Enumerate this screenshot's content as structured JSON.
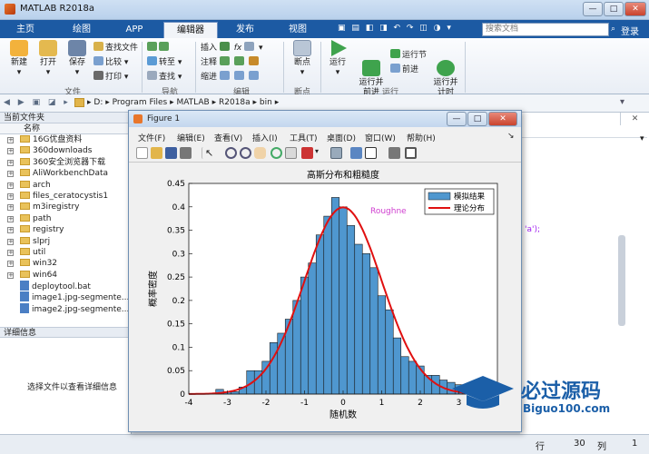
{
  "app": {
    "title": "MATLAB R2018a"
  },
  "window_controls": {
    "minimize": "—",
    "maximize": "□",
    "close": "✕"
  },
  "tabs": [
    {
      "label": "主页"
    },
    {
      "label": "绘图"
    },
    {
      "label": "APP"
    },
    {
      "label": "编辑器"
    },
    {
      "label": "发布"
    },
    {
      "label": "视图"
    }
  ],
  "search": {
    "placeholder": "搜索文档",
    "login": "登录"
  },
  "ribbon": {
    "file": {
      "new": "新建",
      "open": "打开",
      "save": "保存",
      "find_files": "查找文件",
      "compare": "比较",
      "print": "打印",
      "group": "文件"
    },
    "nav": {
      "goto": "转至",
      "find": "查找",
      "group": "导航"
    },
    "edit": {
      "insert": "插入",
      "comment": "注释",
      "indent": "缩进",
      "fx": "fx",
      "group": "编辑"
    },
    "breakpoints": {
      "label": "断点",
      "group": "断点"
    },
    "run": {
      "run": "运行",
      "run_advance": "运行并\n前进",
      "run_section": "运行节",
      "advance": "前进",
      "run_time": "运行并\n计时",
      "group": "运行"
    }
  },
  "address": {
    "path": [
      "D:",
      "Program Files",
      "MATLAB",
      "R2018a",
      "bin"
    ]
  },
  "current_folder": {
    "title": "当前文件夹",
    "col_name": "名称",
    "items": [
      {
        "name": "16G优盘资料",
        "type": "folder"
      },
      {
        "name": "360downloads",
        "type": "folder"
      },
      {
        "name": "360安全浏览器下载",
        "type": "folder"
      },
      {
        "name": "AliWorkbenchData",
        "type": "folder"
      },
      {
        "name": "arch",
        "type": "folder"
      },
      {
        "name": "files_ceratocystis1",
        "type": "folder"
      },
      {
        "name": "m3iregistry",
        "type": "folder"
      },
      {
        "name": "path",
        "type": "folder"
      },
      {
        "name": "registry",
        "type": "folder"
      },
      {
        "name": "slprj",
        "type": "folder"
      },
      {
        "name": "util",
        "type": "folder"
      },
      {
        "name": "win32",
        "type": "folder"
      },
      {
        "name": "win64",
        "type": "folder"
      },
      {
        "name": "deploytool.bat",
        "type": "file"
      },
      {
        "name": "image1.jpg-segmente...",
        "type": "file"
      },
      {
        "name": "image2.jpg-segmente...",
        "type": "file"
      }
    ]
  },
  "details": {
    "title": "详细信息",
    "hint": "选择文件以查看详细信息"
  },
  "editor_snippet": "'a');",
  "status": {
    "row_label": "行",
    "row": "30",
    "col_label": "列",
    "col": "1"
  },
  "figure": {
    "title": "Figure 1",
    "menu": [
      "文件(F)",
      "编辑(E)",
      "查看(V)",
      "插入(I)",
      "工具(T)",
      "桌面(D)",
      "窗口(W)",
      "帮助(H)"
    ],
    "overlay_text": "Roughne"
  },
  "colors": {
    "bars": "#4f97cf",
    "bar_edge": "#1a1a1a",
    "curve": "#e01010",
    "ribbon_tab": "#1c5aa3",
    "overlay": "#d040d0"
  },
  "chart_data": {
    "type": "bar",
    "title": "高斯分布和粗糙度",
    "xlabel": "随机数",
    "ylabel": "概率密度",
    "xlim": [
      -4,
      4
    ],
    "ylim": [
      0,
      0.45
    ],
    "xticks": [
      -4,
      -3,
      -2,
      -1,
      0,
      1,
      2,
      3
    ],
    "yticks": [
      0,
      0.05,
      0.1,
      0.15,
      0.2,
      0.25,
      0.3,
      0.35,
      0.4,
      0.45
    ],
    "bin_width": 0.2,
    "bin_left_edges": [
      -3.3,
      -3.1,
      -2.9,
      -2.7,
      -2.5,
      -2.3,
      -2.1,
      -1.9,
      -1.7,
      -1.5,
      -1.3,
      -1.1,
      -0.9,
      -0.7,
      -0.5,
      -0.3,
      -0.1,
      0.1,
      0.3,
      0.5,
      0.7,
      0.9,
      1.1,
      1.3,
      1.5,
      1.7,
      1.9,
      2.1,
      2.3,
      2.5,
      2.7,
      2.9,
      3.1
    ],
    "series": [
      {
        "name": "模拟结果",
        "values": [
          0.01,
          0.005,
          0.005,
          0.015,
          0.05,
          0.05,
          0.07,
          0.11,
          0.13,
          0.16,
          0.2,
          0.25,
          0.28,
          0.34,
          0.38,
          0.42,
          0.4,
          0.36,
          0.32,
          0.3,
          0.27,
          0.21,
          0.18,
          0.12,
          0.08,
          0.07,
          0.06,
          0.04,
          0.04,
          0.03,
          0.025,
          0.02,
          0.01
        ]
      },
      {
        "name": "理论分布",
        "function": "normal",
        "mean": 0,
        "std": 1
      }
    ],
    "legend": "top-right"
  }
}
